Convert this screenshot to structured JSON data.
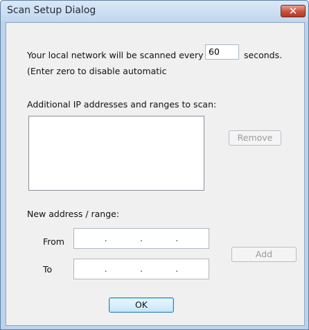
{
  "window": {
    "title": "Scan Setup Dialog",
    "close_glyph": "✕",
    "close_icon": "close-icon"
  },
  "scan": {
    "interval_prefix": "Your local network will be scanned every",
    "interval_value": "60",
    "interval_suffix": "seconds.",
    "zero_hint": "(Enter zero to disable automatic"
  },
  "additional": {
    "label": "Additional IP addresses and ranges to scan:",
    "remove_label": "Remove"
  },
  "range": {
    "label": "New address / range:",
    "from_label": "From",
    "to_label": "To",
    "separator": ".",
    "add_label": "Add"
  },
  "ok_label": "OK"
}
